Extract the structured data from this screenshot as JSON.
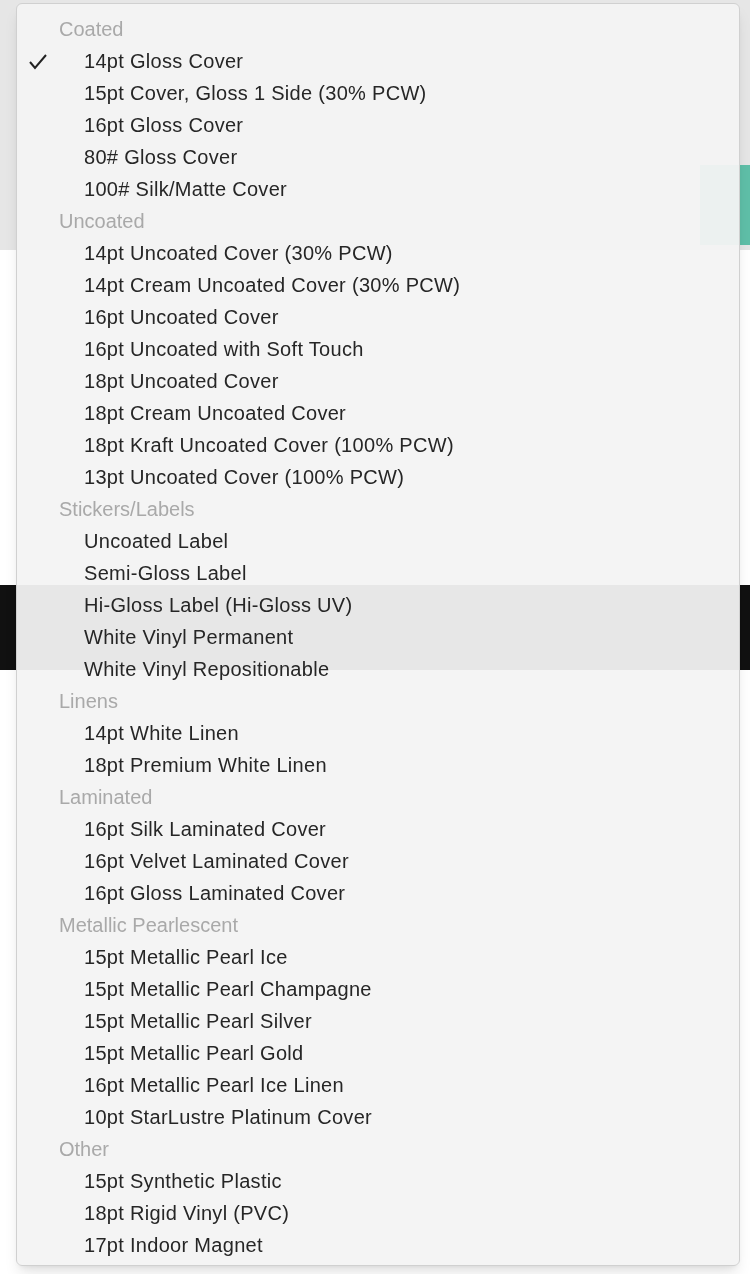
{
  "menu": {
    "groups": [
      {
        "label": "Coated",
        "items": [
          {
            "label": "14pt Gloss Cover",
            "selected": true
          },
          {
            "label": "15pt Cover, Gloss 1 Side (30% PCW)",
            "selected": false
          },
          {
            "label": "16pt Gloss Cover",
            "selected": false
          },
          {
            "label": "80# Gloss Cover",
            "selected": false
          },
          {
            "label": "100# Silk/Matte Cover",
            "selected": false
          }
        ]
      },
      {
        "label": "Uncoated",
        "items": [
          {
            "label": "14pt Uncoated Cover (30% PCW)",
            "selected": false
          },
          {
            "label": "14pt Cream Uncoated Cover (30% PCW)",
            "selected": false
          },
          {
            "label": "16pt Uncoated Cover",
            "selected": false
          },
          {
            "label": "16pt Uncoated with Soft Touch",
            "selected": false
          },
          {
            "label": "18pt Uncoated Cover",
            "selected": false
          },
          {
            "label": "18pt Cream Uncoated Cover",
            "selected": false
          },
          {
            "label": "18pt Kraft Uncoated Cover (100% PCW)",
            "selected": false
          },
          {
            "label": "13pt Uncoated Cover (100% PCW)",
            "selected": false
          }
        ]
      },
      {
        "label": "Stickers/Labels",
        "items": [
          {
            "label": "Uncoated Label",
            "selected": false
          },
          {
            "label": "Semi-Gloss Label",
            "selected": false
          },
          {
            "label": "Hi-Gloss Label (Hi-Gloss UV)",
            "selected": false
          },
          {
            "label": "White Vinyl Permanent",
            "selected": false
          },
          {
            "label": "White Vinyl Repositionable",
            "selected": false
          }
        ]
      },
      {
        "label": "Linens",
        "items": [
          {
            "label": "14pt White Linen",
            "selected": false
          },
          {
            "label": "18pt Premium White Linen",
            "selected": false
          }
        ]
      },
      {
        "label": "Laminated",
        "items": [
          {
            "label": "16pt Silk Laminated Cover",
            "selected": false
          },
          {
            "label": "16pt Velvet Laminated Cover",
            "selected": false
          },
          {
            "label": "16pt Gloss Laminated Cover",
            "selected": false
          }
        ]
      },
      {
        "label": "Metallic Pearlescent",
        "items": [
          {
            "label": "15pt Metallic Pearl Ice",
            "selected": false
          },
          {
            "label": "15pt Metallic Pearl Champagne",
            "selected": false
          },
          {
            "label": "15pt Metallic Pearl Silver",
            "selected": false
          },
          {
            "label": "15pt Metallic Pearl Gold",
            "selected": false
          },
          {
            "label": "16pt Metallic Pearl Ice Linen",
            "selected": false
          },
          {
            "label": "10pt StarLustre Platinum Cover",
            "selected": false
          }
        ]
      },
      {
        "label": "Other",
        "items": [
          {
            "label": "15pt Synthetic Plastic",
            "selected": false
          },
          {
            "label": "18pt Rigid Vinyl (PVC)",
            "selected": false
          },
          {
            "label": "17pt Indoor Magnet",
            "selected": false
          }
        ]
      }
    ]
  }
}
